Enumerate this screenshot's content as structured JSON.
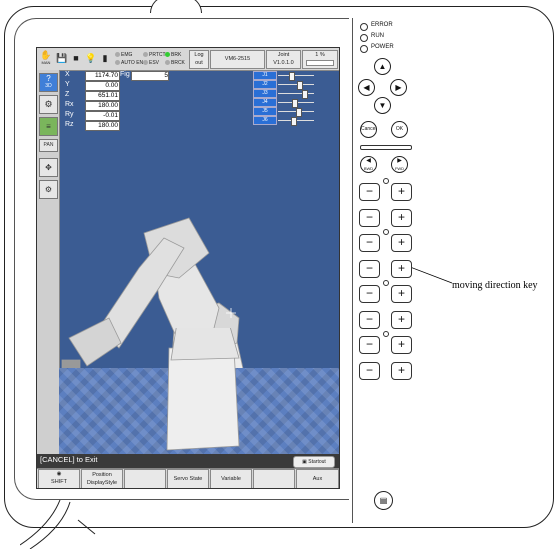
{
  "colors": {
    "screen_bg": "#3b5c93",
    "joint_label_bg": "#2a6fd6",
    "floor": "#5c7fc0",
    "status_bar": "#3a3a3a"
  },
  "toolbar": {
    "hand_label": "MAN",
    "lamps": [
      "EMG",
      "PRTCT",
      "BRK",
      "AUTO EN",
      "ESV",
      "BRCK"
    ],
    "logout_label": "Log out",
    "model_label": "VM6-2515",
    "joint_label": "Joint",
    "joint_version": "V1.0.1.0",
    "speed_label": "1 %"
  },
  "sidebar": {
    "items": [
      {
        "label": "3D",
        "icon": "question-icon"
      },
      {
        "label": "",
        "icon": "robot-icon"
      },
      {
        "label": "",
        "icon": "list-icon"
      },
      {
        "label": "PAN",
        "icon": "pan-icon"
      },
      {
        "label": "",
        "icon": "move-icon"
      },
      {
        "label": "",
        "icon": "gear-icon"
      }
    ]
  },
  "coords": {
    "labels": [
      "X",
      "Y",
      "Z",
      "Rx",
      "Ry",
      "Rz"
    ],
    "values": [
      "1174.70",
      "0.00",
      "651.01",
      "180.00",
      "-0.01",
      "180.00"
    ],
    "fig_label": "Fig",
    "fig_value": "5"
  },
  "joints": {
    "labels": [
      "J1",
      "J2",
      "J3",
      "J4",
      "J5",
      "J6"
    ],
    "positions": [
      0.35,
      0.6,
      0.75,
      0.45,
      0.55,
      0.4
    ]
  },
  "status": {
    "cancel_text": "[CANCEL] to Exit",
    "start_button": "Startout"
  },
  "function_bar": {
    "buttons": [
      "SHIFT",
      "Position DisplayStyle",
      "",
      "Servo State",
      "Variable",
      "",
      "Aux"
    ]
  },
  "panel": {
    "leds": [
      "ERROR",
      "RUN",
      "POWER"
    ],
    "arrow_keys": [
      "▲",
      "◀",
      "▶",
      "▼"
    ],
    "cancel_label": "Cancel",
    "ok_label": "OK",
    "bwd_label": "BWD",
    "fwd_label": "FWD",
    "minus": "−",
    "plus": "+"
  },
  "annotation": {
    "text": "moving direction key"
  }
}
